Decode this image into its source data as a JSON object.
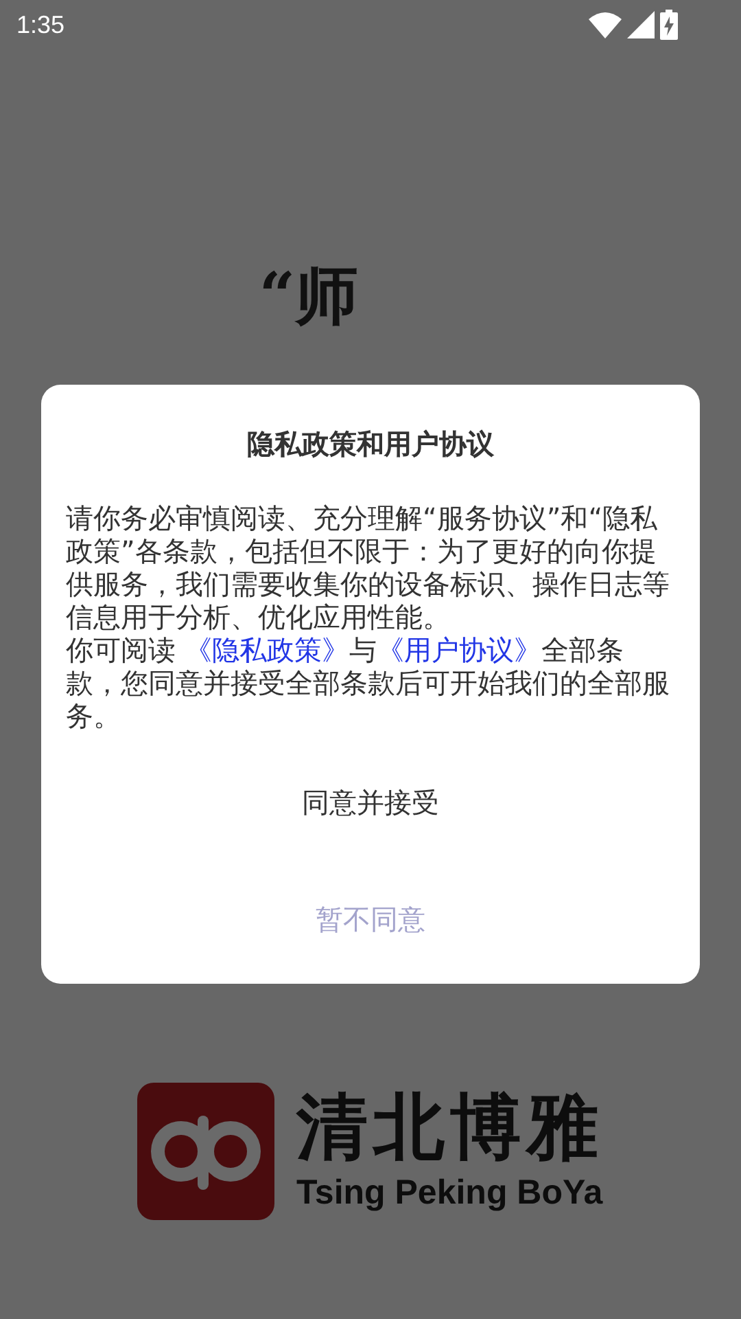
{
  "status_bar": {
    "time": "1:35"
  },
  "splash": {
    "slogan": "“师",
    "brand": {
      "name": "清北博雅",
      "subtitle": "Tsing Peking BoYa"
    }
  },
  "dialog": {
    "title": "隐私政策和用户协议",
    "intro": "请你务必审慎阅读、充分理解“服务协议”和“隐私政策”各条款，包括但不限于：为了更好的向你提供服务，我们需要收集你的设备标识、操作日志等信息用于分析、优化应用性能。",
    "prefix": "你可阅读",
    "links": [
      {
        "label": "《隐私政策》"
      },
      {
        "label": "《用户协议》"
      }
    ],
    "joiner": "与",
    "suffix": "全部条款，您同意并接受全部条款后可开始我们的全部服务。",
    "buttons": [
      {
        "label": "同意并接受",
        "kind": "primary"
      },
      {
        "label": "暂不同意",
        "kind": "secondary"
      }
    ]
  }
}
